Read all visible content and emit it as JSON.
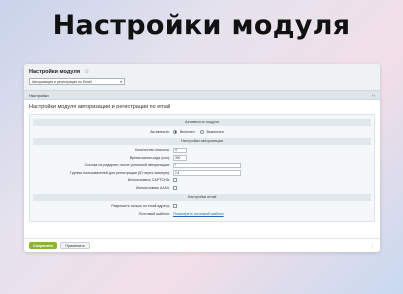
{
  "banner_title": "Настройки модуля",
  "window": {
    "title": "Настройки модуля",
    "module_select_value": "Авторизация и регистрация по Email",
    "tab_label": "Настройки",
    "tab_toggle": "‹›"
  },
  "section_title": "Настройки модуля авторизации и регистрации по email",
  "groups": {
    "activity": {
      "head": "Активность модуля",
      "activity_label": "Активность:",
      "on_label": "Включен",
      "off_label": "Выключен"
    },
    "auth": {
      "head": "Настройки авторизации",
      "code_length_label": "Количество попыток:",
      "code_length_value": "4",
      "lifetime_label": "Время жизни кода (сек):",
      "lifetime_value": "300",
      "redirect_label": "Ссылка на редирект после успешной авторизации:",
      "redirect_value": "/",
      "groups_label": "Группы пользователей для регистрации (ID через запятую):",
      "groups_value": "2,4",
      "captcha_label": "Использовать CAPTCHA:",
      "ajax_label": "Использовать AJAX:"
    },
    "email": {
      "head": "Настройки email",
      "allow_label": "Разрешить только по email адресу:",
      "template_label": "Почтовый шаблон:",
      "template_link": "Посмотреть почтовый шаблон"
    }
  },
  "footer": {
    "save_label": "Сохранить",
    "apply_label": "Применить",
    "more_icon": "⋮"
  }
}
